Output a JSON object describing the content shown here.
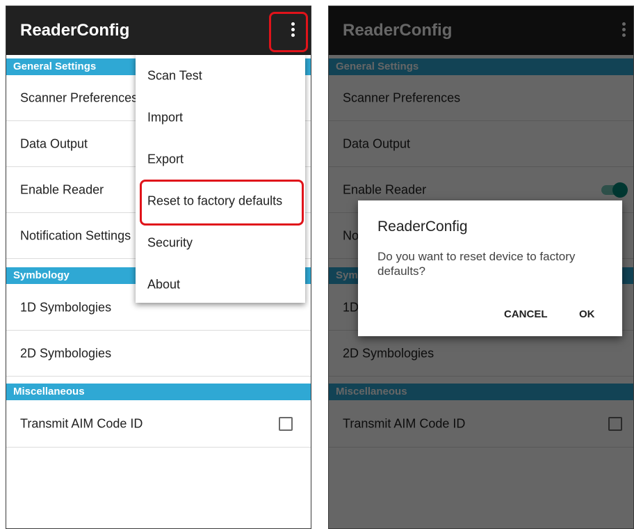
{
  "app_title": "ReaderConfig",
  "sections": {
    "general": "General Settings",
    "symbology": "Symbology",
    "misc": "Miscellaneous"
  },
  "items": {
    "scanner_preferences": "Scanner Preferences",
    "data_output": "Data Output",
    "enable_reader": "Enable Reader",
    "notification_settings": "Notification Settings",
    "symbologies_1d": "1D Symbologies",
    "symbologies_2d": "2D Symbologies",
    "transmit_aim": "Transmit AIM Code ID"
  },
  "overflow_menu": {
    "scan_test": "Scan Test",
    "import": "Import",
    "export": "Export",
    "reset": "Reset to factory defaults",
    "security": "Security",
    "about": "About"
  },
  "dialog": {
    "title": "ReaderConfig",
    "message": "Do you want to reset device to factory defaults?",
    "cancel": "CANCEL",
    "ok": "OK"
  },
  "states": {
    "enable_reader_on": true,
    "transmit_aim_checked": false
  },
  "colors": {
    "appbar": "#212121",
    "section": "#2fa8d4",
    "highlight": "#e0131a",
    "toggle": "#00897b"
  },
  "icons": {
    "overflow": "more-vert-icon",
    "checkbox": "checkbox-unchecked-icon",
    "toggle": "switch-on-icon"
  }
}
